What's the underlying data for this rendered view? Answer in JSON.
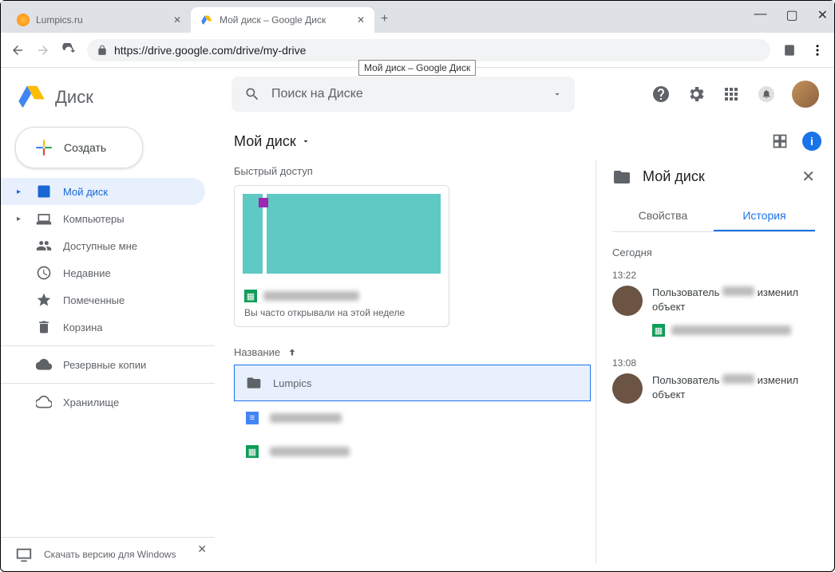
{
  "browser": {
    "tabs": [
      {
        "title": "Lumpics.ru",
        "active": false
      },
      {
        "title": "Мой диск – Google Диск",
        "active": true
      }
    ],
    "url": "https://drive.google.com/drive/my-drive",
    "tooltip": "Мой диск – Google Диск"
  },
  "app_name": "Диск",
  "search": {
    "placeholder": "Поиск на Диске"
  },
  "create_label": "Создать",
  "sidebar": {
    "items": [
      {
        "label": "Мой диск",
        "icon": "drive"
      },
      {
        "label": "Компьютеры",
        "icon": "devices"
      },
      {
        "label": "Доступные мне",
        "icon": "shared"
      },
      {
        "label": "Недавние",
        "icon": "recent"
      },
      {
        "label": "Помеченные",
        "icon": "star"
      },
      {
        "label": "Корзина",
        "icon": "trash"
      }
    ],
    "backups": "Резервные копии",
    "storage": "Хранилище",
    "download_banner": "Скачать версию для Windows"
  },
  "breadcrumb": "Мой диск",
  "quick_access": {
    "title": "Быстрый доступ",
    "subtitle": "Вы часто открывали на этой неделе"
  },
  "list": {
    "header_name": "Название",
    "rows": [
      {
        "name": "Lumpics",
        "type": "folder",
        "selected": true
      },
      {
        "name": "",
        "type": "docs",
        "selected": false
      },
      {
        "name": "",
        "type": "sheets",
        "selected": false
      }
    ]
  },
  "details": {
    "title": "Мой диск",
    "tab_props": "Свойства",
    "tab_history": "История",
    "today": "Сегодня",
    "events": [
      {
        "time": "13:22",
        "actor_prefix": "Пользователь",
        "action": "изменил объект"
      },
      {
        "time": "13:08",
        "actor_prefix": "Пользователь",
        "action": "изменил объект"
      }
    ]
  }
}
